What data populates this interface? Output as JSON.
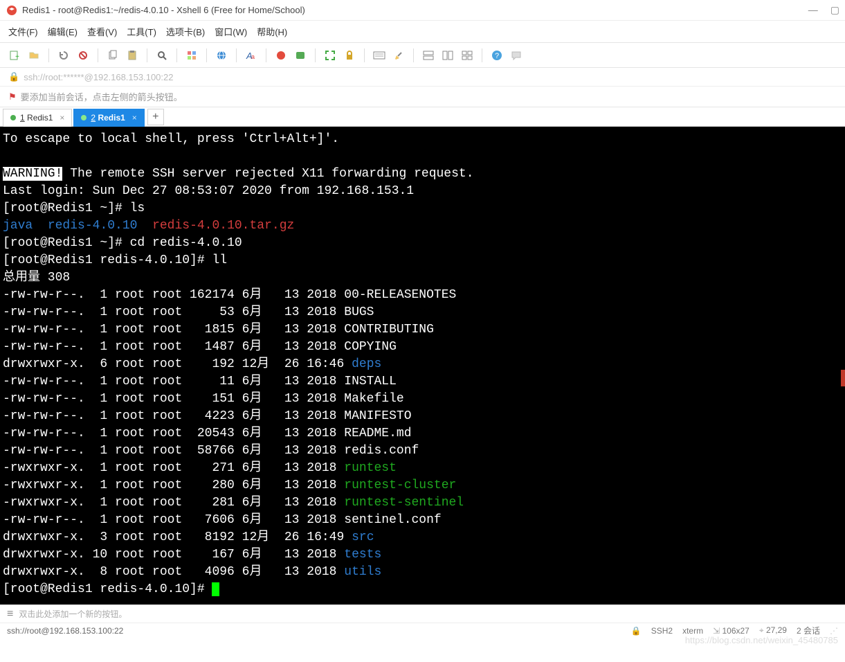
{
  "window": {
    "title": "Redis1 - root@Redis1:~/redis-4.0.10 - Xshell 6 (Free for Home/School)"
  },
  "menu": {
    "file": "文件(F)",
    "edit": "编辑(E)",
    "view": "查看(V)",
    "tools": "工具(T)",
    "tabs": "选项卡(B)",
    "window": "窗口(W)",
    "help": "帮助(H)"
  },
  "address": {
    "url": "ssh://root:******@192.168.153.100:22"
  },
  "hint": {
    "text": "要添加当前会话，点击左侧的箭头按钮。"
  },
  "tabs_row": {
    "items": [
      {
        "index": "1",
        "label": "Redis1",
        "active": false
      },
      {
        "index": "2",
        "label": "Redis1",
        "active": true
      }
    ]
  },
  "terminal": {
    "escape_line": "To escape to local shell, press 'Ctrl+Alt+]'.",
    "warning_label": "WARNING!",
    "warning_rest": " The remote SSH server rejected X11 forwarding request.",
    "last_login": "Last login: Sun Dec 27 08:53:07 2020 from 192.168.153.1",
    "p1_prompt": "[root@Redis1 ~]# ",
    "p1_cmd": "ls",
    "ls_java": "java",
    "ls_dir": "redis-4.0.10",
    "ls_tar": "redis-4.0.10.tar.gz",
    "p2_cmd": "cd redis-4.0.10",
    "p3_prompt": "[root@Redis1 redis-4.0.10]# ",
    "p3_cmd": "ll",
    "total": "总用量 308",
    "rows": [
      {
        "perm": "-rw-rw-r--.",
        "n": " 1",
        "o": "root",
        "g": "root",
        "sz": "162174",
        "mo": "6月 ",
        "d": "13",
        "t": "2018",
        "name": "00-RELEASENOTES",
        "cls": ""
      },
      {
        "perm": "-rw-rw-r--.",
        "n": " 1",
        "o": "root",
        "g": "root",
        "sz": "    53",
        "mo": "6月 ",
        "d": "13",
        "t": "2018",
        "name": "BUGS",
        "cls": ""
      },
      {
        "perm": "-rw-rw-r--.",
        "n": " 1",
        "o": "root",
        "g": "root",
        "sz": "  1815",
        "mo": "6月 ",
        "d": "13",
        "t": "2018",
        "name": "CONTRIBUTING",
        "cls": ""
      },
      {
        "perm": "-rw-rw-r--.",
        "n": " 1",
        "o": "root",
        "g": "root",
        "sz": "  1487",
        "mo": "6月 ",
        "d": "13",
        "t": "2018",
        "name": "COPYING",
        "cls": ""
      },
      {
        "perm": "drwxrwxr-x.",
        "n": " 6",
        "o": "root",
        "g": "root",
        "sz": "   192",
        "mo": "12月",
        "d": "26",
        "t": "16:46",
        "name": "deps",
        "cls": "blue"
      },
      {
        "perm": "-rw-rw-r--.",
        "n": " 1",
        "o": "root",
        "g": "root",
        "sz": "    11",
        "mo": "6月 ",
        "d": "13",
        "t": "2018",
        "name": "INSTALL",
        "cls": ""
      },
      {
        "perm": "-rw-rw-r--.",
        "n": " 1",
        "o": "root",
        "g": "root",
        "sz": "   151",
        "mo": "6月 ",
        "d": "13",
        "t": "2018",
        "name": "Makefile",
        "cls": ""
      },
      {
        "perm": "-rw-rw-r--.",
        "n": " 1",
        "o": "root",
        "g": "root",
        "sz": "  4223",
        "mo": "6月 ",
        "d": "13",
        "t": "2018",
        "name": "MANIFESTO",
        "cls": ""
      },
      {
        "perm": "-rw-rw-r--.",
        "n": " 1",
        "o": "root",
        "g": "root",
        "sz": " 20543",
        "mo": "6月 ",
        "d": "13",
        "t": "2018",
        "name": "README.md",
        "cls": ""
      },
      {
        "perm": "-rw-rw-r--.",
        "n": " 1",
        "o": "root",
        "g": "root",
        "sz": " 58766",
        "mo": "6月 ",
        "d": "13",
        "t": "2018",
        "name": "redis.conf",
        "cls": ""
      },
      {
        "perm": "-rwxrwxr-x.",
        "n": " 1",
        "o": "root",
        "g": "root",
        "sz": "   271",
        "mo": "6月 ",
        "d": "13",
        "t": "2018",
        "name": "runtest",
        "cls": "green"
      },
      {
        "perm": "-rwxrwxr-x.",
        "n": " 1",
        "o": "root",
        "g": "root",
        "sz": "   280",
        "mo": "6月 ",
        "d": "13",
        "t": "2018",
        "name": "runtest-cluster",
        "cls": "green"
      },
      {
        "perm": "-rwxrwxr-x.",
        "n": " 1",
        "o": "root",
        "g": "root",
        "sz": "   281",
        "mo": "6月 ",
        "d": "13",
        "t": "2018",
        "name": "runtest-sentinel",
        "cls": "green"
      },
      {
        "perm": "-rw-rw-r--.",
        "n": " 1",
        "o": "root",
        "g": "root",
        "sz": "  7606",
        "mo": "6月 ",
        "d": "13",
        "t": "2018",
        "name": "sentinel.conf",
        "cls": ""
      },
      {
        "perm": "drwxrwxr-x.",
        "n": " 3",
        "o": "root",
        "g": "root",
        "sz": "  8192",
        "mo": "12月",
        "d": "26",
        "t": "16:49",
        "name": "src",
        "cls": "blue"
      },
      {
        "perm": "drwxrwxr-x.",
        "n": "10",
        "o": "root",
        "g": "root",
        "sz": "   167",
        "mo": "6月 ",
        "d": "13",
        "t": "2018",
        "name": "tests",
        "cls": "blue"
      },
      {
        "perm": "drwxrwxr-x.",
        "n": " 8",
        "o": "root",
        "g": "root",
        "sz": "  4096",
        "mo": "6月 ",
        "d": "13",
        "t": "2018",
        "name": "utils",
        "cls": "blue"
      }
    ]
  },
  "bottom": {
    "hint": "双击此处添加一个新的按钮。"
  },
  "status": {
    "left": "ssh://root@192.168.153.100:22",
    "ssh": "SSH2",
    "term": "xterm",
    "size": "106x27",
    "cursor": "27,29",
    "sessions": "2 会话"
  },
  "watermark": "https://blog.csdn.net/weixin_45480785"
}
